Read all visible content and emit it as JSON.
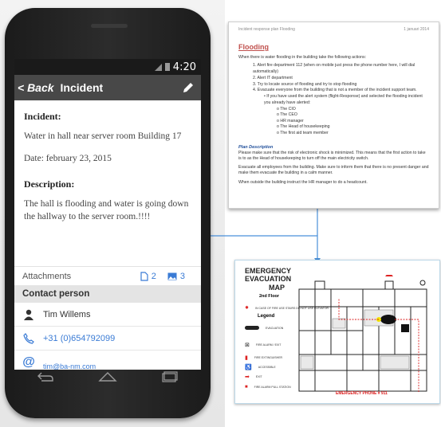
{
  "status": {
    "time": "4:20"
  },
  "appbar": {
    "back_label": "< Back",
    "title": "Incident"
  },
  "incident": {
    "heading": "Incident:",
    "location": "Water in hall near server room  Building 17",
    "date": "Date: february 23, 2015",
    "desc_heading": "Description:",
    "description": "The hall is flooding  and water is going down the hallway to the server room.!!!!"
  },
  "attachments": {
    "label": "Attachments",
    "doc_count": "2",
    "image_count": "3"
  },
  "contact": {
    "heading": "Contact person",
    "name": "Tim Willems",
    "phone": "+31 (0)654792099",
    "email": "tim@ba-nm.com"
  },
  "document": {
    "header_left": "Incident response plan Flooding",
    "header_right": "1 januari 2014",
    "title": "Flooding",
    "intro": "When there is water flooding in the building take the following actions:",
    "steps": [
      "1.   Alert fire department 112 (when on mobile just press the phone number here, I will dial automatically)",
      "2.   Alert IT department",
      "3.   Try to locate source of flooding and try to stop flooding",
      "4.   Evacuate everyone from the building that is not a member of the incident support team."
    ],
    "bullet": "If you have used the alert system (flight-Response) and selected the flooding incident you already have alerted:",
    "alerted": [
      "The CIO",
      "The CEO",
      "HR manager",
      "The Head of housekeeping",
      "The first aid team member"
    ],
    "section2_title": "Plan Description",
    "section2_p1": "Please make sure that the risk of electronic shock is minimized. This means that the first action to take is to as the Head of housekeeping to turn off the main electricity switch.",
    "section2_p2": "Evacuate all employees from the building. Make sure to inform them that there is no present danger and make them evacuate the building in a calm manner.",
    "section2_p3": "When outside the building instruct the HR manager to do a headcount."
  },
  "map": {
    "title_lines": [
      "EMERGENCY",
      "EVACUATION",
      "MAP"
    ],
    "floor": "2nd Floor",
    "legend_label": "Legend",
    "phone_label": "EMERGENCY PHONE # 911",
    "legend_items": [
      "IN CASE OF FIRE USE STAIRS DO NOT USE ELEVATOR",
      "EVACUATION",
      "FIRE ALARM / EXIT",
      "FIRE EXTINGUISHER",
      "ACCESSIBLE",
      "EXIT",
      "FIRE ALARM PULL STATION"
    ]
  },
  "colors": {
    "accent": "#3a7bd5",
    "appbar": "#484848",
    "flooding_title": "#c0504d",
    "connector": "#4a90d9",
    "exit_red": "#d22222"
  }
}
